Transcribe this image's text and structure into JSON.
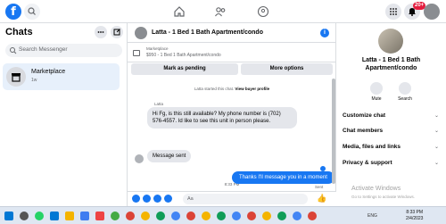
{
  "topbar": {
    "logo": "f",
    "notif_count": "20+"
  },
  "left": {
    "title": "Chats",
    "search_placeholder": "Search Messenger",
    "conversation": {
      "name": "Marketplace",
      "time": "1w"
    }
  },
  "chat": {
    "header_title": "Latta - 1 Bed 1 Bath Apartment/condo",
    "marketplace_label": "Marketplace",
    "listing_sub": "$950 - 1 Bed 1 Bath Apartment/condo",
    "mark_pending_label": "Mark as pending",
    "more_options_label": "More options",
    "started_text": "Latta started this chat.",
    "view_profile_text": "View buyer profile",
    "sender_name": "Latta",
    "message1": "Hi Fg, is this still available? My phone number is (702) 576-4557. Id like to see this unit in person please.",
    "message2": "Message sent",
    "timestamp": "8:33 PM",
    "outgoing_message": "Thanks I'll message you in a moment",
    "sent_label": "Sent",
    "composer_placeholder": "Aa"
  },
  "right": {
    "title": "Latta - 1 Bed 1 Bath Apartment/condo",
    "mute_label": "Mute",
    "search_label": "Search",
    "items": [
      "Customize chat",
      "Chat members",
      "Media, files and links",
      "Privacy & support"
    ],
    "watermark": "Activate Windows",
    "watermark_sub": "Go to Settings to activate Windows."
  },
  "taskbar": {
    "tray_text": "ENG",
    "time": "8:33 PM",
    "date": "2/4/2023"
  }
}
